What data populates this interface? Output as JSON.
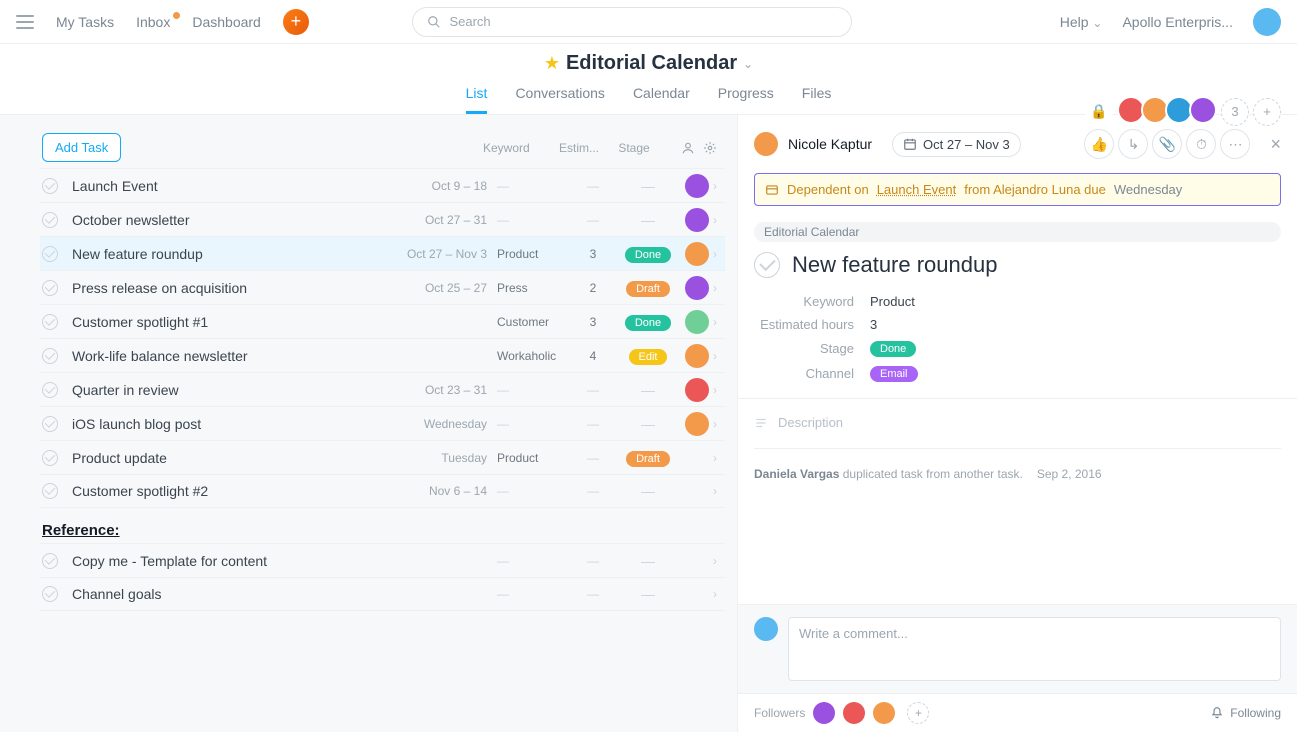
{
  "topnav": {
    "my_tasks": "My Tasks",
    "inbox": "Inbox",
    "dashboard": "Dashboard",
    "search_placeholder": "Search",
    "help": "Help",
    "workspace": "Apollo Enterpris..."
  },
  "project": {
    "title": "Editorial Calendar",
    "tabs": {
      "list": "List",
      "conversations": "Conversations",
      "calendar": "Calendar",
      "progress": "Progress",
      "files": "Files"
    },
    "member_extra_count": "3"
  },
  "member_colors": [
    "#eb5757",
    "#f2994a",
    "#2d9cdb",
    "#9b51e0"
  ],
  "list": {
    "add_task": "Add Task",
    "cols": {
      "keyword": "Keyword",
      "estimate": "Estim...",
      "stage": "Stage"
    },
    "section_reference": "Reference:",
    "tasks": [
      {
        "name": "Launch Event",
        "date": "Oct 9 – 18",
        "keyword": "",
        "est": "",
        "stage": "",
        "av": "#9b51e0"
      },
      {
        "name": "October newsletter",
        "date": "Oct 27 – 31",
        "keyword": "",
        "est": "",
        "stage": "",
        "av": "#9b51e0"
      },
      {
        "name": "New feature roundup",
        "date": "Oct 27 – Nov 3",
        "keyword": "Product",
        "est": "3",
        "stage": "Done",
        "av": "#f2994a",
        "selected": true
      },
      {
        "name": "Press release on acquisition",
        "date": "Oct 25 – 27",
        "keyword": "Press",
        "est": "2",
        "stage": "Draft",
        "av": "#9b51e0"
      },
      {
        "name": "Customer spotlight #1",
        "date": "",
        "keyword": "Customer",
        "est": "3",
        "stage": "Done",
        "av": "#6fcf97"
      },
      {
        "name": "Work-life balance newsletter",
        "date": "",
        "keyword": "Workaholic",
        "est": "4",
        "stage": "Edit",
        "av": "#f2994a"
      },
      {
        "name": "Quarter in review",
        "date": "Oct 23 – 31",
        "keyword": "",
        "est": "",
        "stage": "",
        "av": "#eb5757"
      },
      {
        "name": "iOS launch blog post",
        "date": "Wednesday",
        "keyword": "",
        "est": "",
        "stage": "",
        "av": "#f2994a"
      },
      {
        "name": "Product update",
        "date": "Tuesday",
        "keyword": "Product",
        "est": "",
        "stage": "Draft",
        "av": ""
      },
      {
        "name": "Customer spotlight #2",
        "date": "Nov 6 – 14",
        "keyword": "",
        "est": "",
        "stage": "",
        "av": ""
      }
    ],
    "reference_tasks": [
      {
        "name": "Copy me - Template for content"
      },
      {
        "name": "Channel goals"
      }
    ]
  },
  "detail": {
    "assignee": "Nicole Kaptur",
    "date": "Oct 27 – Nov 3",
    "dependency": {
      "prefix": "Dependent on",
      "task": "Launch Event",
      "from": "from Alejandro Luna due",
      "due": "Wednesday"
    },
    "project_chip": "Editorial Calendar",
    "title": "New feature roundup",
    "fields": {
      "keyword_label": "Keyword",
      "keyword_val": "Product",
      "hours_label": "Estimated hours",
      "hours_val": "3",
      "stage_label": "Stage",
      "stage_val": "Done",
      "channel_label": "Channel",
      "channel_val": "Email"
    },
    "description_label": "Description",
    "history": {
      "actor": "Daniela Vargas",
      "text": "duplicated task from another task.",
      "date": "Sep 2, 2016"
    },
    "comment_placeholder": "Write a comment...",
    "followers_label": "Followers",
    "following_label": "Following"
  }
}
